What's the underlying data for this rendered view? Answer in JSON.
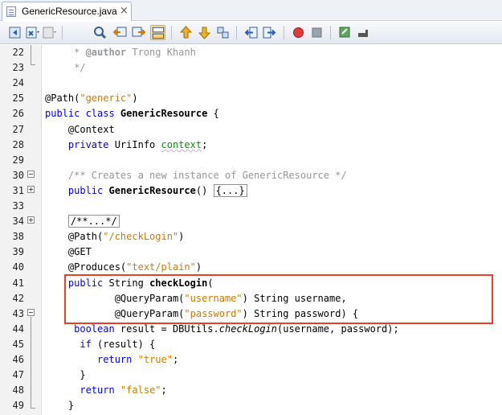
{
  "tab": {
    "title": "GenericResource.java",
    "close": "×"
  },
  "toolbar": {
    "icons": [
      "back-icon",
      "history-icon",
      "forward-icon",
      "find-icon",
      "find-previous-icon",
      "find-next-icon",
      "toggle-highlight-icon",
      "previous-bookmark-icon",
      "next-bookmark-icon",
      "toggle-bookmark-icon",
      "shift-left-icon",
      "shift-right-icon",
      "start-macro-icon",
      "stop-macro-icon",
      "comment-icon",
      "uncomment-icon"
    ]
  },
  "editor": {
    "lines": [
      {
        "num": "22",
        "tokens": [
          {
            "t": "     * ",
            "c": "c"
          },
          {
            "t": "@author",
            "c": "cb"
          },
          {
            "t": " Trong Khanh",
            "c": "c"
          }
        ]
      },
      {
        "num": "23",
        "tokens": [
          {
            "t": "     */",
            "c": "c"
          }
        ]
      },
      {
        "num": "24",
        "tokens": []
      },
      {
        "num": "25",
        "tokens": [
          {
            "t": "@Path(",
            "c": ""
          },
          {
            "t": "\"generic\"",
            "c": "s"
          },
          {
            "t": ")",
            "c": ""
          }
        ]
      },
      {
        "num": "26",
        "tokens": [
          {
            "t": "public class ",
            "c": "k"
          },
          {
            "t": "GenericResource",
            "c": "b"
          },
          {
            "t": " {",
            "c": ""
          }
        ]
      },
      {
        "num": "27",
        "tokens": [
          {
            "t": "    @Context",
            "c": ""
          }
        ]
      },
      {
        "num": "28",
        "tokens": [
          {
            "t": "    ",
            "c": ""
          },
          {
            "t": "private",
            "c": "k"
          },
          {
            "t": " UriInfo ",
            "c": ""
          },
          {
            "t": "context",
            "c": "f"
          },
          {
            "t": ";",
            "c": ""
          }
        ]
      },
      {
        "num": "29",
        "tokens": []
      },
      {
        "num": "30",
        "tokens": [
          {
            "t": "    /** Creates a new instance of GenericResource */",
            "c": "c"
          }
        ]
      },
      {
        "num": "31",
        "tokens": [
          {
            "t": "    ",
            "c": ""
          },
          {
            "t": "public",
            "c": "k"
          },
          {
            "t": " ",
            "c": ""
          },
          {
            "t": "GenericResource",
            "c": "b"
          },
          {
            "t": "() ",
            "c": ""
          },
          {
            "t": "{...}",
            "c": "collapsed"
          }
        ]
      },
      {
        "num": "33",
        "tokens": []
      },
      {
        "num": "34",
        "tokens": [
          {
            "t": "    ",
            "c": ""
          },
          {
            "t": "/**...*/",
            "c": "collapsed"
          }
        ]
      },
      {
        "num": "38",
        "tokens": [
          {
            "t": "    @Path(",
            "c": ""
          },
          {
            "t": "\"/checkLogin\"",
            "c": "s"
          },
          {
            "t": ")",
            "c": ""
          }
        ]
      },
      {
        "num": "39",
        "tokens": [
          {
            "t": "    @GET",
            "c": ""
          }
        ]
      },
      {
        "num": "40",
        "tokens": [
          {
            "t": "    @Produces(",
            "c": ""
          },
          {
            "t": "\"text/plain\"",
            "c": "s"
          },
          {
            "t": ")",
            "c": ""
          }
        ]
      },
      {
        "num": "41",
        "tokens": [
          {
            "t": "    ",
            "c": ""
          },
          {
            "t": "public",
            "c": "k"
          },
          {
            "t": " String ",
            "c": ""
          },
          {
            "t": "checkLogin",
            "c": "b"
          },
          {
            "t": "(",
            "c": ""
          }
        ]
      },
      {
        "num": "42",
        "tokens": [
          {
            "t": "            @QueryParam(",
            "c": ""
          },
          {
            "t": "\"username\"",
            "c": "s"
          },
          {
            "t": ") String username,",
            "c": ""
          }
        ]
      },
      {
        "num": "43",
        "tokens": [
          {
            "t": "            @QueryParam(",
            "c": ""
          },
          {
            "t": "\"password\"",
            "c": "s"
          },
          {
            "t": ") String password) {",
            "c": ""
          }
        ]
      },
      {
        "num": "44",
        "tokens": [
          {
            "t": "     ",
            "c": ""
          },
          {
            "t": "boolean",
            "c": "k"
          },
          {
            "t": " result = DBUtils.",
            "c": ""
          },
          {
            "t": "checkLogin",
            "c": "i"
          },
          {
            "t": "(username, password);",
            "c": ""
          }
        ]
      },
      {
        "num": "45",
        "tokens": [
          {
            "t": "      ",
            "c": ""
          },
          {
            "t": "if",
            "c": "k"
          },
          {
            "t": " (result) {",
            "c": ""
          }
        ]
      },
      {
        "num": "46",
        "tokens": [
          {
            "t": "         ",
            "c": ""
          },
          {
            "t": "return",
            "c": "k"
          },
          {
            "t": " ",
            "c": ""
          },
          {
            "t": "\"true\"",
            "c": "s"
          },
          {
            "t": ";",
            "c": ""
          }
        ]
      },
      {
        "num": "47",
        "tokens": [
          {
            "t": "      }",
            "c": ""
          }
        ]
      },
      {
        "num": "48",
        "tokens": [
          {
            "t": "      ",
            "c": ""
          },
          {
            "t": "return",
            "c": "k"
          },
          {
            "t": " ",
            "c": ""
          },
          {
            "t": "\"false\"",
            "c": "s"
          },
          {
            "t": ";",
            "c": ""
          }
        ]
      },
      {
        "num": "49",
        "tokens": [
          {
            "t": "    }",
            "c": ""
          }
        ]
      }
    ]
  },
  "colors": {
    "highlight_border": "#e8412a",
    "keyword": "#0000e6",
    "string": "#ce7b00",
    "comment": "#969696"
  }
}
